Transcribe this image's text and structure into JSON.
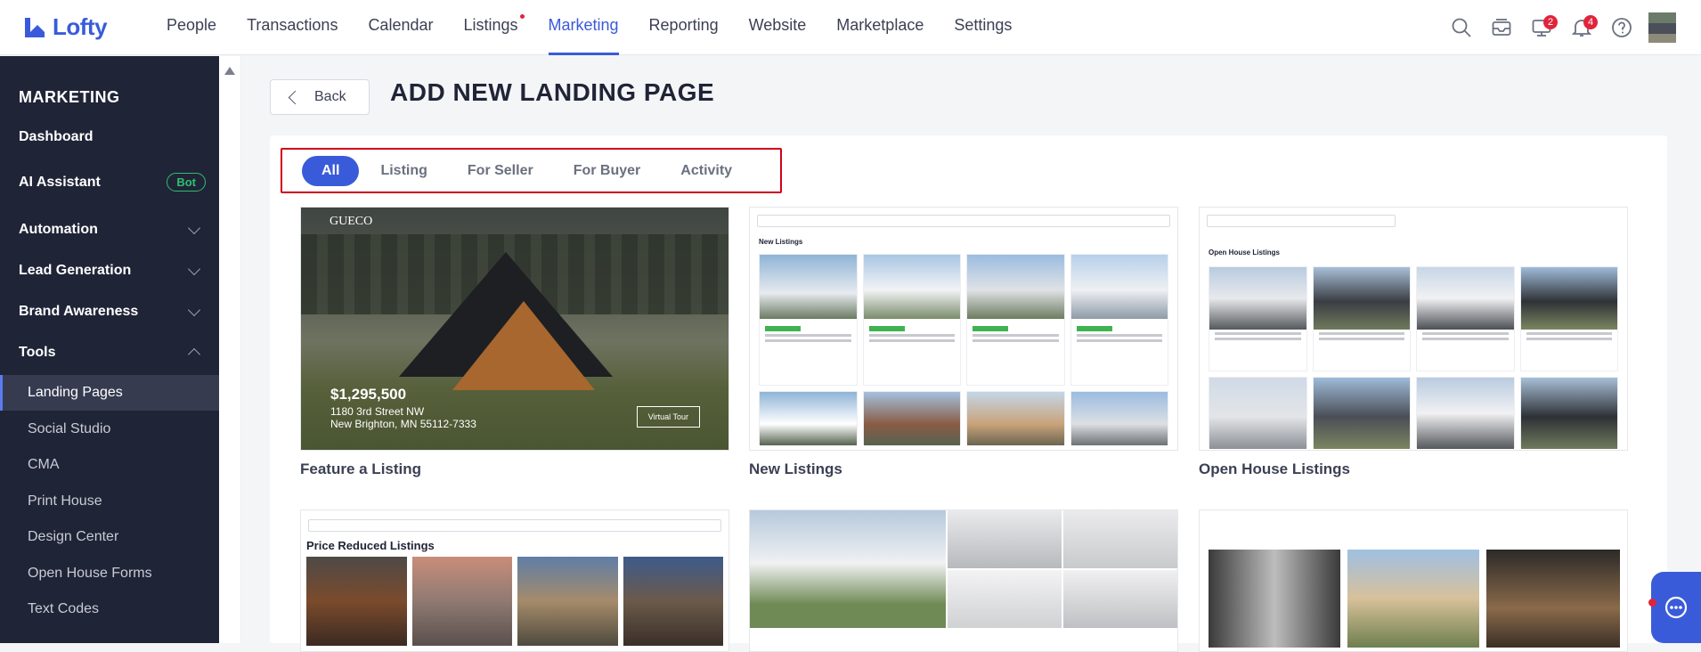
{
  "app": {
    "brand": "Lofty"
  },
  "nav": {
    "items": [
      {
        "label": "People"
      },
      {
        "label": "Transactions"
      },
      {
        "label": "Calendar"
      },
      {
        "label": "Listings"
      },
      {
        "label": "Marketing"
      },
      {
        "label": "Reporting"
      },
      {
        "label": "Website"
      },
      {
        "label": "Marketplace"
      },
      {
        "label": "Settings"
      }
    ],
    "active": "Marketing",
    "badges": {
      "messages": "2",
      "notifications": "4"
    }
  },
  "sidebar": {
    "title": "MARKETING",
    "items": [
      {
        "label": "Dashboard"
      },
      {
        "label": "AI Assistant",
        "badge": "Bot"
      },
      {
        "label": "Automation"
      },
      {
        "label": "Lead Generation"
      },
      {
        "label": "Brand Awareness"
      },
      {
        "label": "Tools"
      }
    ],
    "tools": [
      {
        "label": "Landing Pages"
      },
      {
        "label": "Social Studio"
      },
      {
        "label": "CMA"
      },
      {
        "label": "Print House"
      },
      {
        "label": "Design Center"
      },
      {
        "label": "Open House Forms"
      },
      {
        "label": "Text Codes"
      }
    ]
  },
  "header": {
    "back_label": "Back",
    "title": "ADD NEW LANDING PAGE"
  },
  "filters": [
    "All",
    "Listing",
    "For Seller",
    "For Buyer",
    "Activity"
  ],
  "templates": [
    {
      "label": "Feature a Listing",
      "price": "$1,295,500",
      "address1": "1180 3rd Street NW",
      "address2": "New Brighton, MN 55112-7333",
      "cta": "Virtual Tour",
      "brand": "GUECO"
    },
    {
      "label": "New Listings",
      "heading": "New Listings"
    },
    {
      "label": "Open House Listings",
      "heading": "Open House Listings"
    },
    {
      "label": "",
      "heading": "Price Reduced Listings"
    },
    {
      "label": ""
    },
    {
      "label": ""
    }
  ],
  "colors": {
    "accent": "#3a5bd9",
    "sidebar_bg": "#202437",
    "highlight_border": "#d0021b"
  }
}
